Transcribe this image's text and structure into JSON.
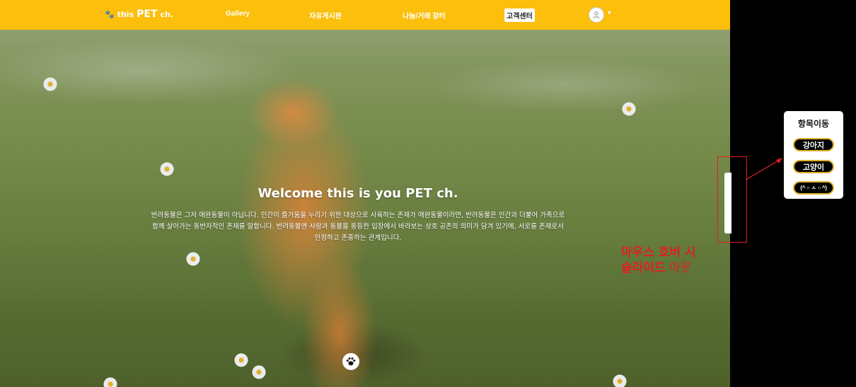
{
  "header": {
    "logo": {
      "part1": "this",
      "part2": "PET",
      "part3": " ch."
    },
    "nav": [
      "Gallery",
      "자유게시판",
      "나눔/거래 장터",
      "고객센터"
    ],
    "active_nav": "고객센터"
  },
  "hero": {
    "title": "Welcome this is you PET ch.",
    "description": "반려동물은 그저 애완동물이 아닙니다. 인간이 즐거움을 누리기 위한 대상으로 사육하는 존재가 애완동물이라면, 반려동물은 인간과 더불어 가족으로 함께 살아가는 동반자적인 존재를 말합니다. 반려동물엔 사람과 동물을 동등한 입장에서 바라보는 상호 공존의 의미가 담겨 있기에, 서로를 존재로서 인정하고 존중하는 관계입니다."
  },
  "side_panel": {
    "title": "항목이동",
    "buttons": [
      "강아지",
      "고양이",
      "(^ ○ ㅅ ○ ^)"
    ]
  },
  "annotation": {
    "line1": "마우스 호버 시",
    "line2_bold": "슬라이드",
    "line2_thin": " 아웃"
  },
  "colors": {
    "header_bg": "#fbbf0c",
    "annotation_red": "#e02020",
    "panel_button_border": "#e0b12e"
  }
}
